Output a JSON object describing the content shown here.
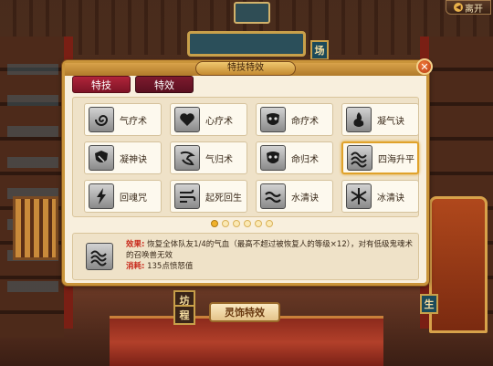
{
  "top_bar": {
    "leave_label": "离开"
  },
  "scene_signs": {
    "a": "场",
    "b": "生",
    "c": "坊",
    "d": "程"
  },
  "dialog": {
    "title": "特技特效",
    "close_symbol": "✕",
    "tabs": [
      {
        "label": "特技",
        "active": true
      },
      {
        "label": "特效",
        "active": false
      }
    ],
    "skills": [
      {
        "label": "气疗术",
        "icon": "spiral-icon",
        "selected": false
      },
      {
        "label": "心疗术",
        "icon": "heart-icon",
        "selected": false
      },
      {
        "label": "命疗术",
        "icon": "mask-icon",
        "selected": false
      },
      {
        "label": "凝气诀",
        "icon": "flame-icon",
        "selected": false
      },
      {
        "label": "凝神诀",
        "icon": "shield-icon",
        "selected": false
      },
      {
        "label": "气归术",
        "icon": "swirl-icon",
        "selected": false
      },
      {
        "label": "命归术",
        "icon": "mask-icon",
        "selected": false
      },
      {
        "label": "四海升平",
        "icon": "wave-icon",
        "selected": true
      },
      {
        "label": "回魂咒",
        "icon": "bolt-icon",
        "selected": false
      },
      {
        "label": "起死回生",
        "icon": "wind-icon",
        "selected": false
      },
      {
        "label": "水清诀",
        "icon": "water-icon",
        "selected": false
      },
      {
        "label": "冰清诀",
        "icon": "ice-icon",
        "selected": false
      }
    ],
    "page_count": 6,
    "active_page": 1,
    "detail": {
      "effect_key": "效果:",
      "effect_text": "恢复全体队友1/4的气血（最高不超过被恢复人的等级×12），对有低级鬼魂术的召唤兽无效",
      "cost_key": "消耗:",
      "cost_text": "135点愤怒值"
    }
  },
  "bottom_button_label": "灵饰特效",
  "colors": {
    "accent": "#c8281a",
    "gold": "#c9943a",
    "tab": "#b0243a"
  }
}
